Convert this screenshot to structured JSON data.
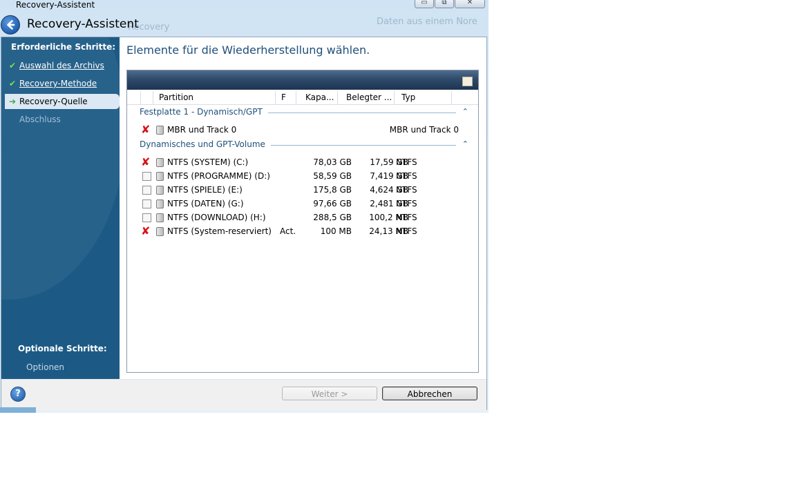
{
  "window": {
    "title": "Recovery-Assistent",
    "header_title": "Recovery-Assistent",
    "minimize_glyph": "▭",
    "maximize_glyph": "⧉",
    "close_glyph": "✕"
  },
  "background_ghost": {
    "left": "Recovery",
    "right": "Daten aus einem Nore"
  },
  "sidebar": {
    "required_heading": "Erforderliche Schritte:",
    "steps": [
      {
        "label": "Auswahl des Archivs",
        "state": "done",
        "icon": "check-icon"
      },
      {
        "label": "Recovery-Methode",
        "state": "done",
        "icon": "check-icon"
      },
      {
        "label": "Recovery-Quelle",
        "state": "current",
        "icon": "arrow-right-icon"
      },
      {
        "label": "Abschluss",
        "state": "pending",
        "icon": ""
      }
    ],
    "optional_heading": "Optionale Schritte:",
    "optional_items": [
      {
        "label": "Optionen"
      }
    ]
  },
  "main": {
    "title": "Elemente für die Wiederherstellung wählen.",
    "columns": [
      "Partition",
      "F",
      "Kapa...",
      "Belegter ...",
      "Typ"
    ],
    "groups": [
      {
        "title": "Festplatte  1 - Dynamisch/GPT",
        "toggle": "⌃",
        "rows": [
          {
            "name": "MBR und Track 0",
            "flag": "",
            "capacity": "",
            "used": "",
            "type": "MBR und Track 0",
            "check": "x"
          }
        ]
      },
      {
        "title": "Dynamisches und GPT-Volume",
        "toggle": "⌃",
        "rows": [
          {
            "name": "NTFS (SYSTEM) (C:)",
            "flag": "",
            "capacity": "78,03 GB",
            "used": "17,59 GB",
            "type": "NTFS",
            "check": "x"
          },
          {
            "name": "NTFS (PROGRAMME) (D:)",
            "flag": "",
            "capacity": "58,59 GB",
            "used": "7,419 GB",
            "type": "NTFS",
            "check": "empty"
          },
          {
            "name": "NTFS (SPIELE) (E:)",
            "flag": "",
            "capacity": "175,8 GB",
            "used": "4,624 GB",
            "type": "NTFS",
            "check": "empty"
          },
          {
            "name": "NTFS (DATEN) (G:)",
            "flag": "",
            "capacity": "97,66 GB",
            "used": "2,481 GB",
            "type": "NTFS",
            "check": "empty"
          },
          {
            "name": "NTFS (DOWNLOAD) (H:)",
            "flag": "",
            "capacity": "288,5 GB",
            "used": "100,2 MB",
            "type": "NTFS",
            "check": "empty"
          },
          {
            "name": "NTFS (System-reserviert)",
            "flag": "Act.",
            "capacity": "100 MB",
            "used": "24,13 MB",
            "type": "NTFS",
            "check": "x"
          }
        ]
      }
    ]
  },
  "footer": {
    "help": "?",
    "next_label": "Weiter >",
    "cancel_label": "Abbrechen"
  },
  "colors": {
    "sidebar": "#1c5a85",
    "accent_text": "#1e4f7a",
    "x_mark": "#d8141b",
    "check": "#7be04a"
  }
}
